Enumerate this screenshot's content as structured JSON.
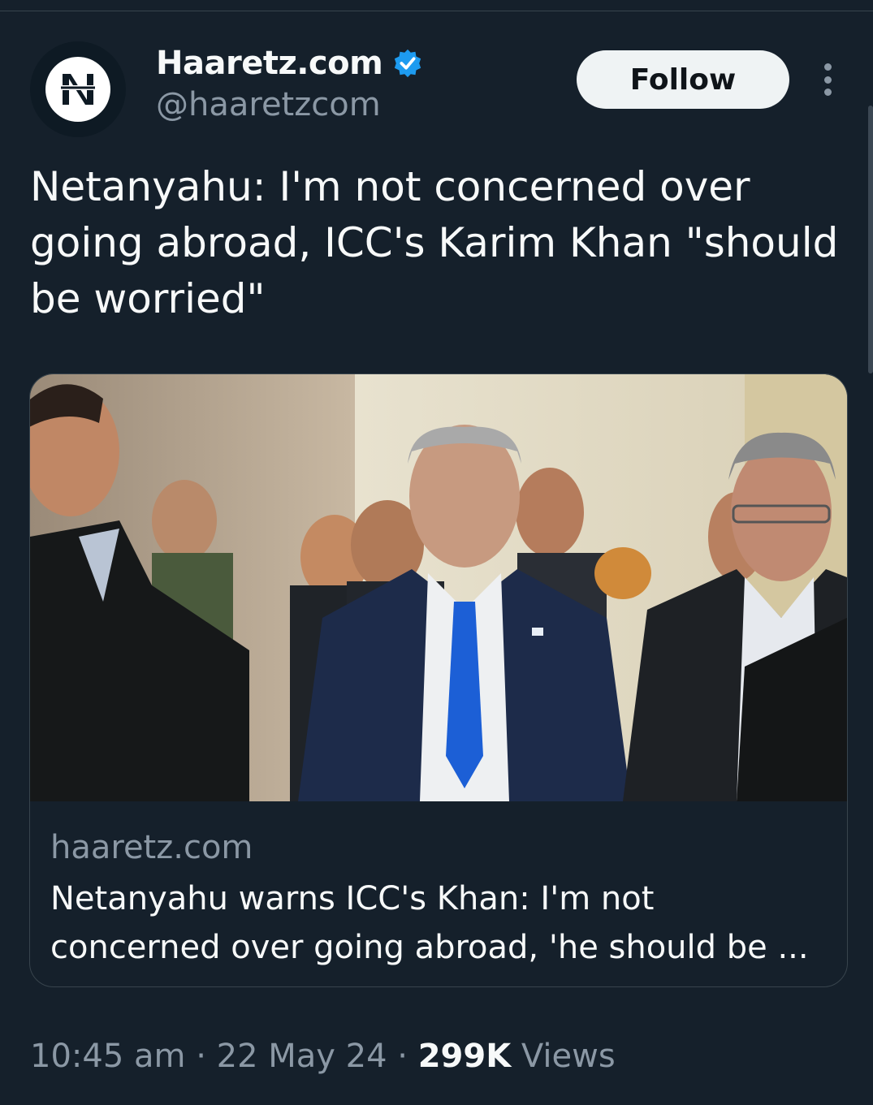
{
  "author": {
    "display_name": "Haaretz.com",
    "handle": "@haaretzcom",
    "verified": true,
    "avatar_icon": "haaretz-logo-icon"
  },
  "actions": {
    "follow_label": "Follow",
    "more_icon": "more-vertical-icon"
  },
  "tweet": {
    "text": "Netanyahu: I'm not concerned over going abroad, ICC's Karim Khan \"should be worried\""
  },
  "card": {
    "image_icon": "news-photo-image",
    "domain": "haaretz.com",
    "title": "Netanyahu warns ICC's Khan: I'm not concerned over going abroad, 'he should be ..."
  },
  "meta": {
    "time": "10:45 am",
    "date": "22 May 24",
    "separator": "·",
    "views_count": "299K",
    "views_label": "Views"
  },
  "colors": {
    "background": "#15202b",
    "text_primary": "#f7f9f9",
    "text_secondary": "#8b98a5",
    "verified_blue": "#1d9bf0",
    "tie_blue": "#1c5fd6"
  }
}
